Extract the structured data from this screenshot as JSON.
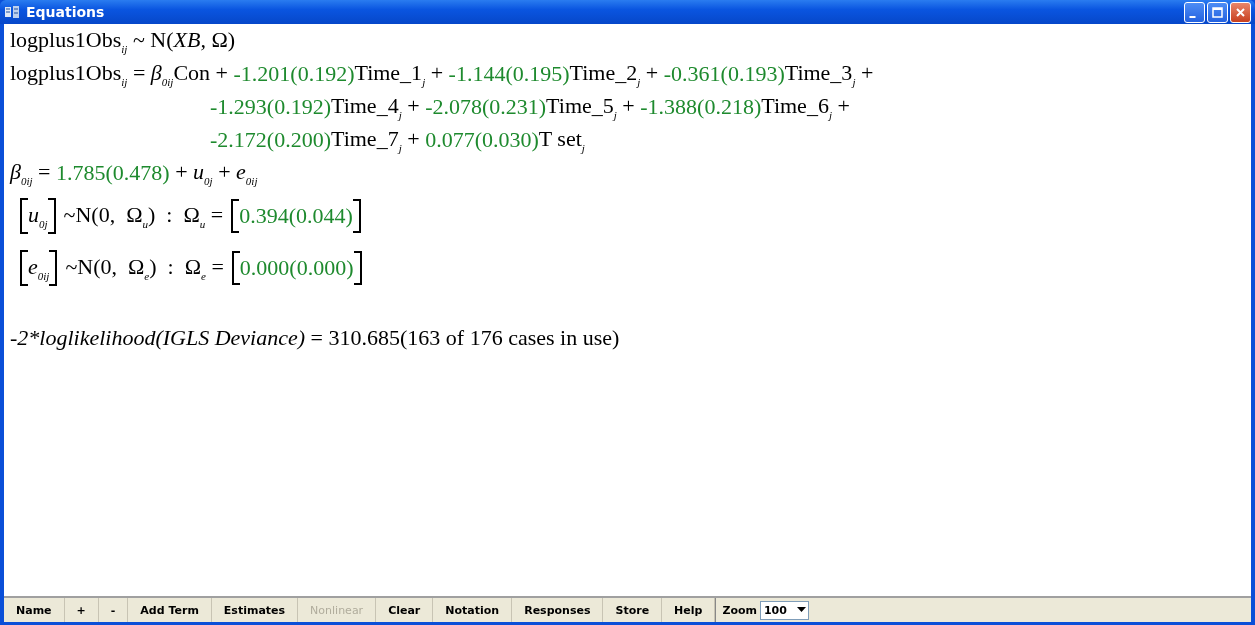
{
  "window": {
    "title": "Equations"
  },
  "lines": [
    {
      "kind": "main",
      "segments": [
        {
          "kind": "text",
          "text": "logplus1Obs$_{ij}$ ~ N(*XB,* Ω)"
        }
      ]
    },
    {
      "kind": "main",
      "segments": [
        {
          "kind": "text",
          "text": "logplus1Obs$_{ij}$ = *β*$_{0ij}$Con + "
        },
        {
          "kind": "estimate",
          "text": "-1.201(0.192)"
        },
        {
          "kind": "text",
          "text": "Time_1$_{j}$ + "
        },
        {
          "kind": "estimate",
          "text": "-1.144(0.195)"
        },
        {
          "kind": "text",
          "text": "Time_2$_{j}$ + "
        },
        {
          "kind": "estimate",
          "text": "-0.361(0.193)"
        },
        {
          "kind": "text",
          "text": "Time_3$_{j}$ +"
        }
      ]
    },
    {
      "kind": "continuation",
      "segments": [
        {
          "kind": "estimate",
          "text": "-1.293(0.192)"
        },
        {
          "kind": "text",
          "text": "Time_4$_{j}$ + "
        },
        {
          "kind": "estimate",
          "text": "-2.078(0.231)"
        },
        {
          "kind": "text",
          "text": "Time_5$_{j}$ + "
        },
        {
          "kind": "estimate",
          "text": "-1.388(0.218)"
        },
        {
          "kind": "text",
          "text": "Time_6$_{j}$ +"
        }
      ]
    },
    {
      "kind": "continuation",
      "segments": [
        {
          "kind": "estimate",
          "text": "-2.172(0.200)"
        },
        {
          "kind": "text",
          "text": "Time_7$_{j}$ + "
        },
        {
          "kind": "estimate",
          "text": "0.077(0.030)"
        },
        {
          "kind": "text",
          "text": "T set$_{j}$"
        }
      ]
    },
    {
      "kind": "main",
      "segments": [
        {
          "kind": "text",
          "text": "*β*$_{0ij}$ = "
        },
        {
          "kind": "estimate",
          "text": "1.785(0.478)"
        },
        {
          "kind": "text",
          "text": " + *u*$_{0j}$ + *e*$_{0ij}$"
        }
      ]
    },
    {
      "kind": "matrix",
      "segments": [
        {
          "kind": "matrix",
          "text": "*u*$_{0j}$"
        },
        {
          "kind": "text",
          "text": "~N(0,  Ω$_{u}$)  :  Ω$_{u}$ ="
        },
        {
          "kind": "matrix_estimate",
          "text": "0.394(0.044)"
        }
      ]
    },
    {
      "kind": "matrix",
      "segments": [
        {
          "kind": "matrix",
          "text": "*e*$_{0ij}$"
        },
        {
          "kind": "text",
          "text": "~N(0,  Ω$_{e}$)  :  Ω$_{e}$ ="
        },
        {
          "kind": "matrix_estimate",
          "text": "0.000(0.000)"
        }
      ]
    },
    {
      "kind": "summary",
      "segments": [
        {
          "kind": "italic",
          "text": "-2*loglikelihood(IGLS Deviance)"
        },
        {
          "kind": "text",
          "text": " = 310.685(163 of 176 cases in use)"
        }
      ]
    }
  ],
  "toolbar": {
    "buttons": [
      {
        "label": "Name",
        "disabled": false
      },
      {
        "label": "+",
        "disabled": false
      },
      {
        "label": "-",
        "disabled": false
      },
      {
        "label": "Add Term",
        "disabled": false
      },
      {
        "label": "Estimates",
        "disabled": false
      },
      {
        "label": "Nonlinear",
        "disabled": true
      },
      {
        "label": "Clear",
        "disabled": false
      },
      {
        "label": "Notation",
        "disabled": false
      },
      {
        "label": "Responses",
        "disabled": false
      },
      {
        "label": "Store",
        "disabled": false
      },
      {
        "label": "Help",
        "disabled": false
      }
    ],
    "zoom_label": "Zoom",
    "zoom_value": "100"
  }
}
